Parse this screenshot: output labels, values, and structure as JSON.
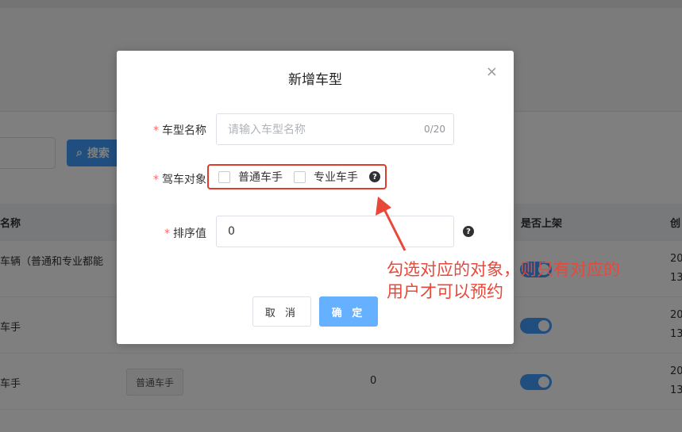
{
  "background": {
    "search_button": "搜索",
    "table_headers": [
      "名称",
      "是否上架",
      "创"
    ],
    "rows": [
      {
        "name": "车辆（普通和专业都能",
        "date1": "20",
        "date2": "13"
      },
      {
        "name": "车手",
        "date1": "20",
        "date2": "13"
      },
      {
        "name": "车手",
        "tag": "普通车手",
        "sort": "0",
        "date1": "20",
        "date2": "13"
      }
    ]
  },
  "dialog": {
    "title": "新增车型",
    "close_glyph": "×",
    "fields": {
      "name_label": "车型名称",
      "name_placeholder": "请输入车型名称",
      "name_counter": "0/20",
      "target_label": "驾车对象",
      "option_normal": "普通车手",
      "option_pro": "专业车手",
      "sort_label": "排序值",
      "sort_value": "0"
    },
    "required_mark": "*",
    "help_glyph": "?",
    "cancel_label": "取 消",
    "confirm_label": "确 定"
  },
  "annotation": {
    "line1": "勾选对应的对象，则只有对应的",
    "line2": "用户才可以预约",
    "color": "#e8483a"
  },
  "colors": {
    "primary": "#409eff",
    "required": "#f56c6c",
    "highlight_border": "#e03c2c"
  }
}
